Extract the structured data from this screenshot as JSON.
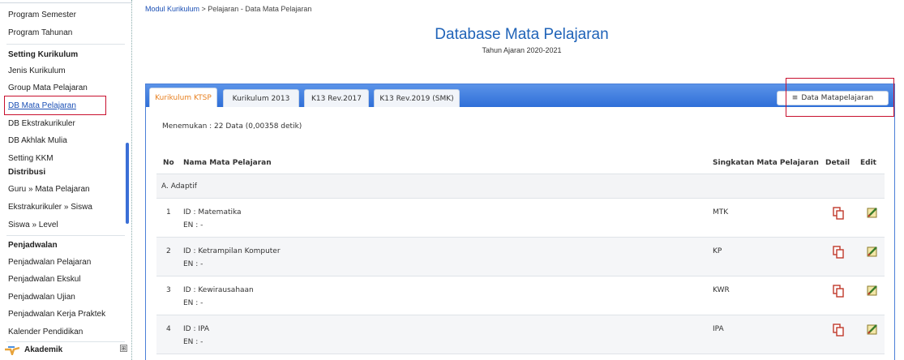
{
  "sidebar": {
    "items_top": [
      "Program Semester",
      "Program Tahunan"
    ],
    "setting_head": "Setting Kurikulum",
    "setting_items": [
      "Jenis Kurikulum",
      "Group Mata Pelajaran",
      "DB Mata Pelajaran",
      "DB Ekstrakurikuler",
      "DB Akhlak Mulia",
      "Setting KKM"
    ],
    "distribusi_head": "Distribusi",
    "distribusi_items": [
      "Guru » Mata Pelajaran",
      "Ekstrakurikuler » Siswa",
      "Siswa » Level"
    ],
    "penjadwalan_head": "Penjadwalan",
    "penjadwalan_items": [
      "Penjadwalan Pelajaran",
      "Penjadwalan Ekskul",
      "Penjadwalan Ujian",
      "Penjadwalan Kerja Praktek",
      "Kalender Pendidikan"
    ],
    "akademik_label": "Akademik",
    "expand_symbol": "⊞",
    "active_item": "DB Mata Pelajaran"
  },
  "breadcrumb": {
    "link": "Modul Kurikulum",
    "rest": " > Pelajaran - Data Mata Pelajaran"
  },
  "header": {
    "title": "Database Mata Pelajaran",
    "subtitle": "Tahun Ajaran 2020-2021"
  },
  "tabs": [
    "Kurikulum KTSP",
    "Kurikulum 2013",
    "K13 Rev.2017",
    "K13 Rev.2019 (SMK)"
  ],
  "active_tab": "Kurikulum KTSP",
  "data_button": {
    "label": "Data Matapelajaran",
    "icon": "menu-icon"
  },
  "result_text": "Menemukan : 22 Data (0,00358 detik)",
  "table": {
    "columns": {
      "no": "No",
      "name": "Nama Mata Pelajaran",
      "short": "Singkatan Mata Pelajaran",
      "detail": "Detail",
      "edit": "Edit"
    },
    "group": "A. Adaptif",
    "rows": [
      {
        "no": "1",
        "id": "ID : Matematika",
        "en": "EN : -",
        "short": "MTK"
      },
      {
        "no": "2",
        "id": "ID : Ketrampilan Komputer",
        "en": "EN : -",
        "short": "KP"
      },
      {
        "no": "3",
        "id": "ID : Kewirausahaan",
        "en": "EN : -",
        "short": "KWR"
      },
      {
        "no": "4",
        "id": "ID : IPA",
        "en": "EN : -",
        "short": "IPA"
      }
    ]
  },
  "colors": {
    "accent": "#1f63b8",
    "tab_active": "#e88020",
    "highlight": "#c8102e",
    "tabbar": "#2f6fd8"
  }
}
